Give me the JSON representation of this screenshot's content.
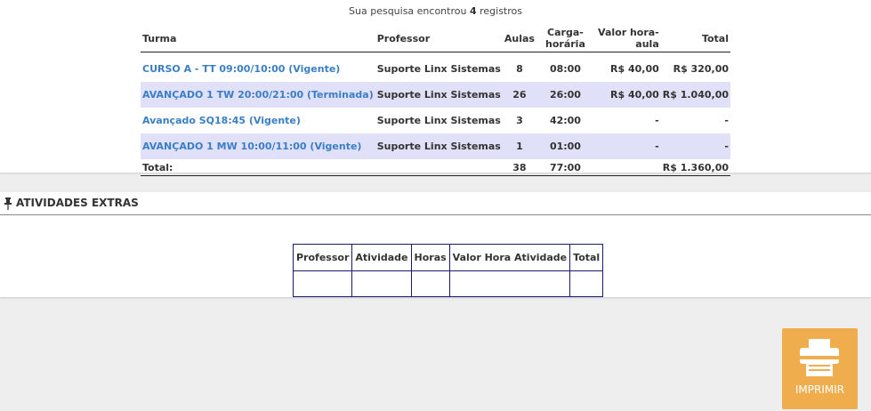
{
  "summary": {
    "prefix": "Sua pesquisa encontrou ",
    "count": "4",
    "suffix": " registros"
  },
  "table": {
    "headers": [
      "Turma",
      "Professor",
      "Aulas",
      "Carga-horária",
      "Valor hora-aula",
      "Total"
    ],
    "rows": [
      {
        "turma": "CURSO A - TT 09:00/10:00 (Vigente)",
        "professor": "Suporte Linx Sistemas",
        "aulas": "8",
        "carga": "08:00",
        "valor": "R$ 40,00",
        "total": "R$ 320,00"
      },
      {
        "turma": "AVANÇADO 1 TW 20:00/21:00 (Terminada)",
        "professor": "Suporte Linx Sistemas",
        "aulas": "26",
        "carga": "26:00",
        "valor": "R$ 40,00",
        "total": "R$ 1.040,00"
      },
      {
        "turma": "Avançado SQ18:45 (Vigente)",
        "professor": "Suporte Linx Sistemas",
        "aulas": "3",
        "carga": "42:00",
        "valor": "-",
        "total": "-"
      },
      {
        "turma": "AVANÇADO 1 MW 10:00/11:00 (Vigente)",
        "professor": "Suporte Linx Sistemas",
        "aulas": "1",
        "carga": "01:00",
        "valor": "-",
        "total": "-"
      }
    ],
    "totals": {
      "label": "Total:",
      "aulas": "38",
      "carga": "77:00",
      "total": "R$ 1.360,00"
    }
  },
  "extras": {
    "title": "ATIVIDADES EXTRAS",
    "icon": "pin-icon",
    "headers": [
      "Professor",
      "Atividade",
      "Horas",
      "Valor Hora Atividade",
      "Total"
    ]
  },
  "print_button": {
    "label": "IMPRIMIR",
    "icon": "printer-icon",
    "color": "#f0ad4e"
  },
  "colors": {
    "link": "#3a7fc4",
    "row_alt": "#e0e0f8",
    "table_border": "#1a1a6e"
  }
}
